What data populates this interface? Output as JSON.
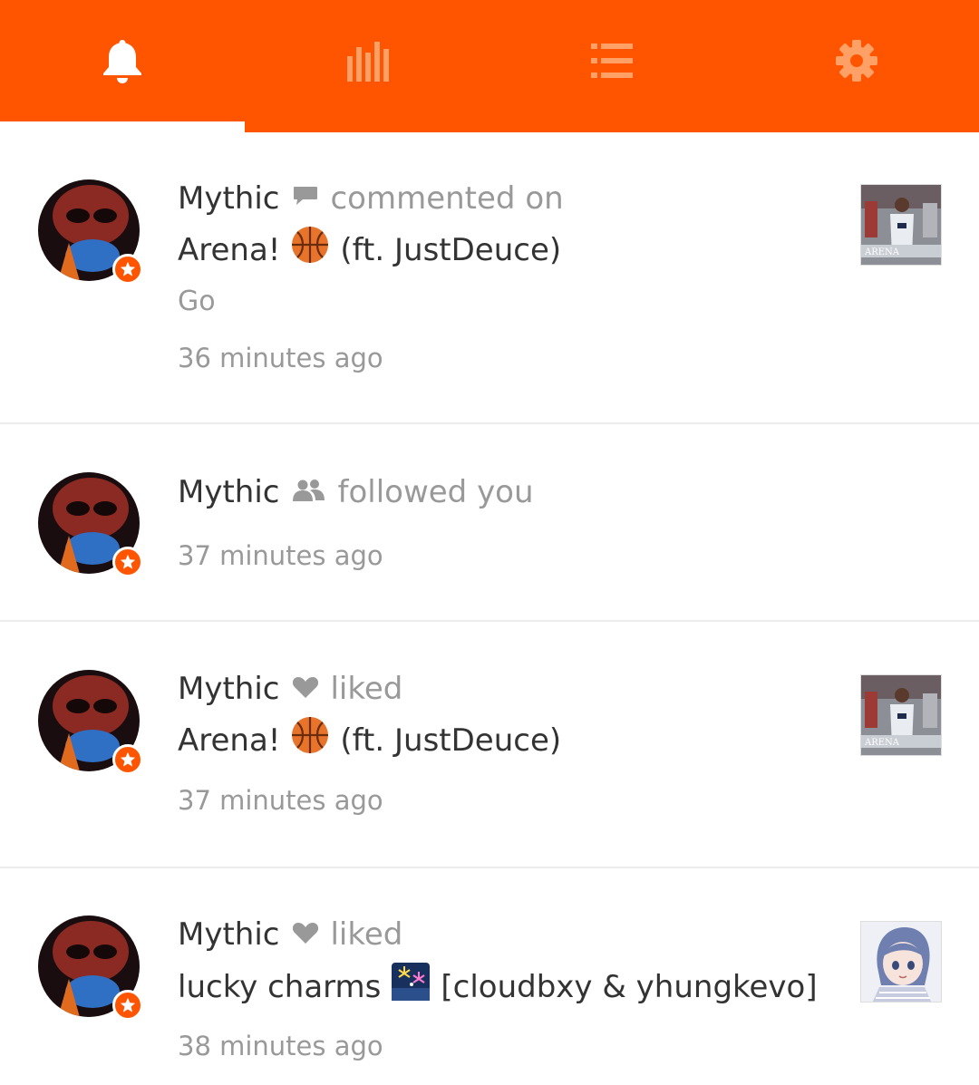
{
  "colors": {
    "brand": "#ff5500",
    "text": "#333333",
    "muted": "#999999",
    "divider": "#ececec"
  },
  "tabs": [
    {
      "icon": "bell-icon",
      "active": true
    },
    {
      "icon": "stats-icon",
      "active": false
    },
    {
      "icon": "list-icon",
      "active": false
    },
    {
      "icon": "gear-icon",
      "active": false
    }
  ],
  "notifications": [
    {
      "user": "Mythic",
      "action_icon": "comment-icon",
      "action": "commented on",
      "track_title": "Arena!",
      "track_emoji": "basketball",
      "track_suffix": "(ft. JustDeuce)",
      "comment": "Go",
      "time": "36 minutes ago",
      "artwork": "arena-artwork"
    },
    {
      "user": "Mythic",
      "action_icon": "followers-icon",
      "action": "followed you",
      "time": "37 minutes ago"
    },
    {
      "user": "Mythic",
      "action_icon": "heart-icon",
      "action": "liked",
      "track_title": "Arena!",
      "track_emoji": "basketball",
      "track_suffix": "(ft. JustDeuce)",
      "time": "37 minutes ago",
      "artwork": "arena-artwork"
    },
    {
      "user": "Mythic",
      "action_icon": "heart-icon",
      "action": "liked",
      "track_title": "lucky charms",
      "track_emoji": "fireworks",
      "track_suffix": "[cloudbxy & yhungkevo]",
      "time": "38 minutes ago",
      "artwork": "anime-artwork"
    }
  ]
}
